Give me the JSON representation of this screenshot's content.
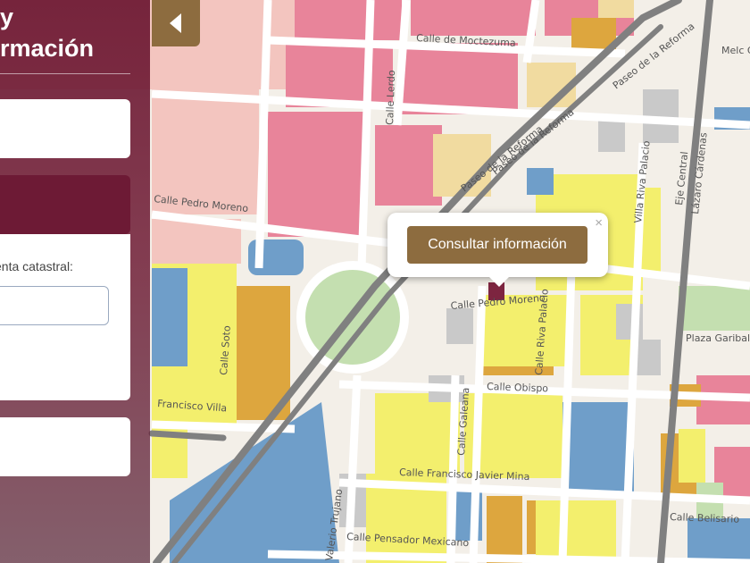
{
  "sidebar": {
    "title": "y\nrmación",
    "label": "enta catastral:",
    "account_value": ""
  },
  "toggle_icon": "caret-left-icon",
  "popup": {
    "button_label": "Consultar información",
    "close_glyph": "×"
  },
  "map": {
    "streets": {
      "moctezuma": "Calle de Moctezuma",
      "lerdo": "Calle Lerdo",
      "reforma_top": "Paseo de la Reforma",
      "reforma_mid": "Paseo de la Reforma",
      "reforma_low": "Paseo de la Reforma",
      "moreno_left": "Calle Pedro Moreno",
      "pedro_moreno": "Calle Pedro Moreno",
      "villa_riva_palacio": "Villa Riva Palacio",
      "eje_central": "Eje Central",
      "lazaro_cardenas": "Lázaro Cárdenas",
      "soto": "Calle Soto",
      "riva_palacio": "Calle Riva Palacio",
      "plaza_garibaldi": "Plaza Garibaldi",
      "obispo": "Calle Obispo",
      "galeana": "Calle Galeana",
      "francisco_mina": "Calle Francisco Javier Mina",
      "belisario": "Calle Belisario",
      "pensador_mexicano": "Calle Pensador Mexicano",
      "trujano": "Valerio Trujano",
      "francisco_villa_left": "Francisco Villa",
      "melchor_ocampo": "Melc Garib Lagun"
    },
    "colors": {
      "pink": "#e8849a",
      "light_pink": "#f3c5bf",
      "yellow": "#f3ef6d",
      "orange": "#dda63e",
      "blue": "#6f9ec9",
      "gray": "#c9c9c9",
      "green": "#c4dfb0",
      "road_dark": "#808080",
      "accent_brown": "#8d6c3f",
      "sidebar_maroon": "#6d1a35"
    }
  }
}
